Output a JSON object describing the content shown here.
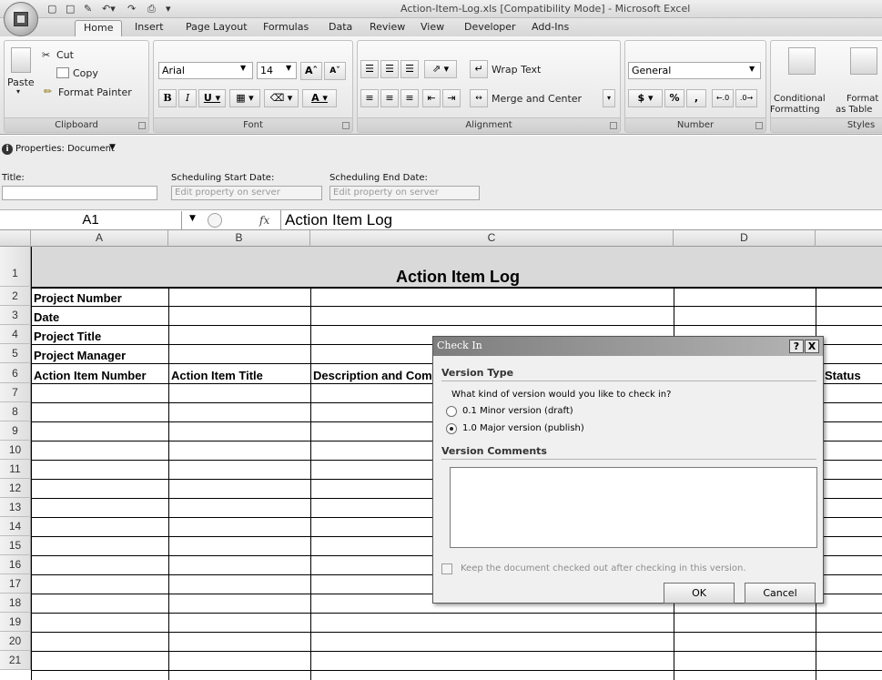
{
  "window": {
    "title": "Action-Item-Log.xls  [Compatibility Mode] - Microsoft Excel"
  },
  "tabs": [
    "Home",
    "Insert",
    "Page Layout",
    "Formulas",
    "Data",
    "Review",
    "View",
    "Developer",
    "Add-Ins"
  ],
  "ribbon": {
    "clipboard": {
      "label": "Clipboard",
      "paste": "Paste",
      "cut": "Cut",
      "copy": "Copy",
      "format_painter": "Format Painter"
    },
    "font": {
      "label": "Font",
      "name": "Arial",
      "size": "14"
    },
    "alignment": {
      "label": "Alignment",
      "wrap": "Wrap Text",
      "merge": "Merge and Center"
    },
    "number": {
      "label": "Number",
      "format": "General",
      "currency": "$",
      "percent": "%",
      "comma": ","
    },
    "styles": {
      "label": "Styles",
      "conditional": "Conditional",
      "conditional2": "Formatting",
      "format_table": "Format",
      "format_table2": "as Table"
    }
  },
  "properties": {
    "header": "Properties: Document",
    "title_label": "Title:",
    "start_label": "Scheduling Start Date:",
    "end_label": "Scheduling End Date:",
    "start_placeholder": "Edit property on server",
    "end_placeholder": "Edit property on server"
  },
  "formula_bar": {
    "name_box": "A1",
    "fx": "fx",
    "content": "Action Item Log"
  },
  "sheet": {
    "columns": [
      "A",
      "B",
      "C",
      "D"
    ],
    "rows": [
      "1",
      "2",
      "3",
      "4",
      "5",
      "6",
      "7",
      "8",
      "9",
      "10",
      "11",
      "12",
      "13",
      "14",
      "15",
      "16",
      "17",
      "18",
      "19",
      "20",
      "21"
    ],
    "title": "Action Item Log",
    "labels": [
      "Project Number",
      "Date",
      "Project Title",
      "Project Manager"
    ],
    "headers": [
      "Action Item Number",
      "Action Item Title",
      "Description and Comments",
      "Status"
    ]
  },
  "dialog": {
    "title": "Check In",
    "help": "?",
    "close": "X",
    "version_type": "Version Type",
    "question": "What kind of version would you like to check in?",
    "minor": "0.1 Minor version (draft)",
    "major": "1.0 Major version (publish)",
    "selected": "major",
    "comments_label": "Version Comments",
    "comments_value": "",
    "keep_checked_out": "Keep the document checked out after checking in this version.",
    "ok": "OK",
    "cancel": "Cancel"
  }
}
